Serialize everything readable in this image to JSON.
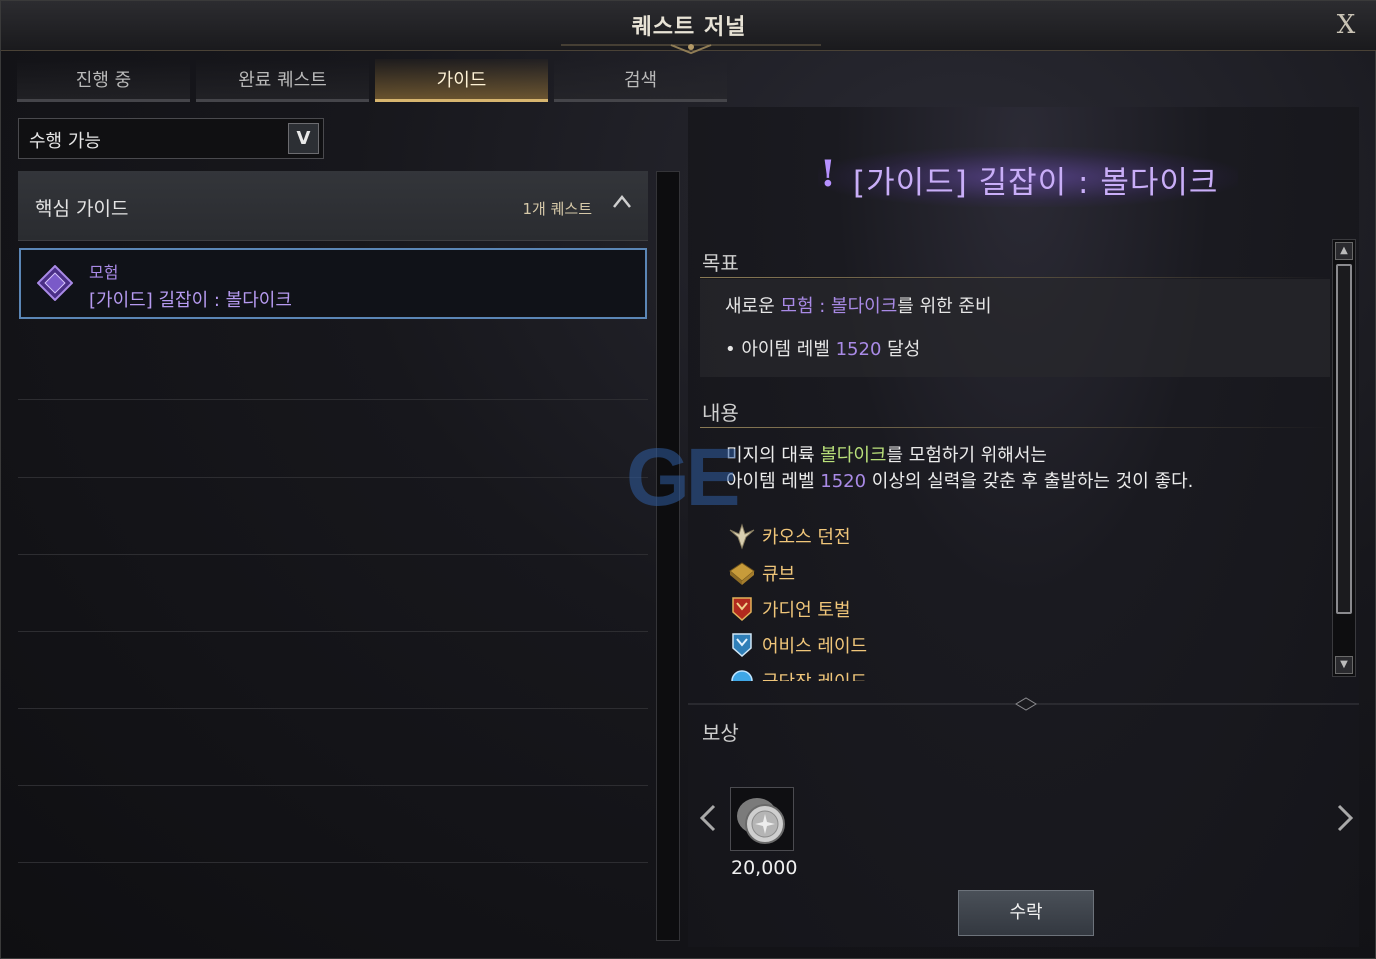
{
  "window": {
    "title": "퀘스트 저널",
    "close_label": "X"
  },
  "tabs": [
    {
      "label": "진행 중",
      "active": false
    },
    {
      "label": "완료 퀘스트",
      "active": false
    },
    {
      "label": "가이드",
      "active": true
    },
    {
      "label": "검색",
      "active": false
    }
  ],
  "filter": {
    "selected": "수행 가능",
    "arrow": "V"
  },
  "group": {
    "title": "핵심 가이드",
    "count": "1개 퀘스트",
    "toggle": "^"
  },
  "quest_item": {
    "category": "모험",
    "name": "[가이드] 길잡이 : 볼다이크",
    "icon": "diamond-quest-icon"
  },
  "detail": {
    "banner_mark": "!",
    "banner_title": "[가이드] 길잡이 : 볼다이크",
    "objective_title": "목표",
    "objective_main": {
      "before": "새로운 ",
      "highlight": "모험 : 볼다이크",
      "after": "를 위한 준비"
    },
    "objective_sub": {
      "bullet": "•",
      "before": "아이템 레벨 ",
      "number": "1520",
      "after": " 달성"
    },
    "content_title": "내용",
    "content_line1": {
      "before": "미지의 대륙 ",
      "highlight": "볼다이크",
      "after": "를 모험하기 위해서는"
    },
    "content_line2": {
      "before": "아이템 레벨 ",
      "number": "1520",
      "after": " 이상의 실력을 갖춘 후 출발하는 것이 좋다."
    },
    "content_items": [
      {
        "label": "카오스 던전",
        "icon": "chaos-dungeon-icon"
      },
      {
        "label": "큐브",
        "icon": "cube-icon"
      },
      {
        "label": "가디언 토벌",
        "icon": "guardian-raid-icon"
      },
      {
        "label": "어비스 레이드",
        "icon": "abyss-raid-icon"
      },
      {
        "label": "군단장 레이드",
        "icon": "legion-raid-icon"
      }
    ],
    "reward_title": "보상",
    "reward": {
      "amount": "20,000",
      "icon": "silver-coin-icon"
    },
    "accept_label": "수락"
  },
  "colors": {
    "accent_gold": "#d7b56f",
    "quest_purple": "#a98ae6",
    "highlight_green": "#b9e07a",
    "item_orange": "#f0c67a",
    "selection_blue": "#5b86b6"
  },
  "watermark": "GE"
}
